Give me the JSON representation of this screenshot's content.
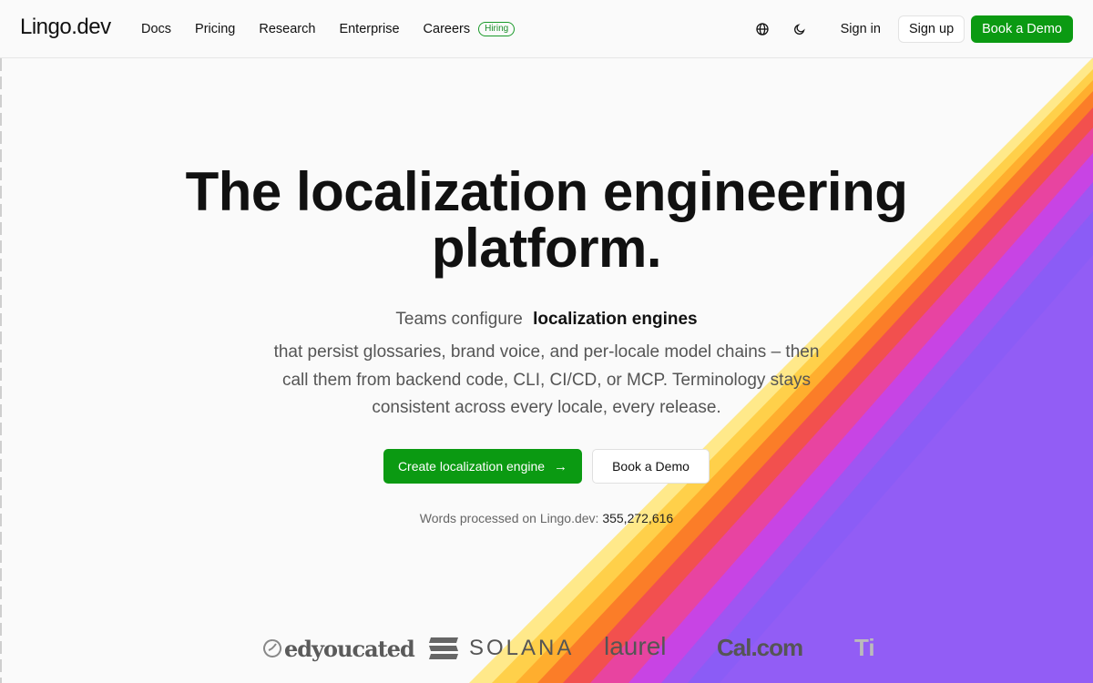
{
  "header": {
    "logo": "Lingo.dev",
    "nav": [
      {
        "label": "Docs"
      },
      {
        "label": "Pricing"
      },
      {
        "label": "Research"
      },
      {
        "label": "Enterprise"
      },
      {
        "label": "Careers",
        "badge": "Hiring"
      }
    ],
    "signin": "Sign in",
    "signup": "Sign up",
    "demo": "Book a Demo",
    "icons": [
      "globe-icon",
      "moon-icon"
    ]
  },
  "hero": {
    "title": "The localization engineering platform.",
    "sub_lead": "Teams configure",
    "sub_strong": "localization engines",
    "sub_body": "that persist glossaries, brand voice, and per-locale model chains – then call them from backend code, CLI, CI/CD, or MCP. Terminology stays consistent across every locale, every release.",
    "cta_primary": "Create localization engine",
    "cta_secondary": "Book a Demo",
    "counter_label": "Words processed on Lingo.dev:",
    "counter_value": "355,272,616"
  },
  "logos": {
    "edyoucated": "edyoucated",
    "solana": "SOLANA",
    "laurel": "laurel",
    "calcom": "Cal.com",
    "partial": "Ti"
  },
  "colors": {
    "accent": "#0b9a12",
    "rainbow": [
      "#ffe98a",
      "#ffd04a",
      "#ffae2e",
      "#fb7d28",
      "#f2504e",
      "#e844a0",
      "#c844e4",
      "#9f55f2",
      "#8b5cf6"
    ]
  }
}
